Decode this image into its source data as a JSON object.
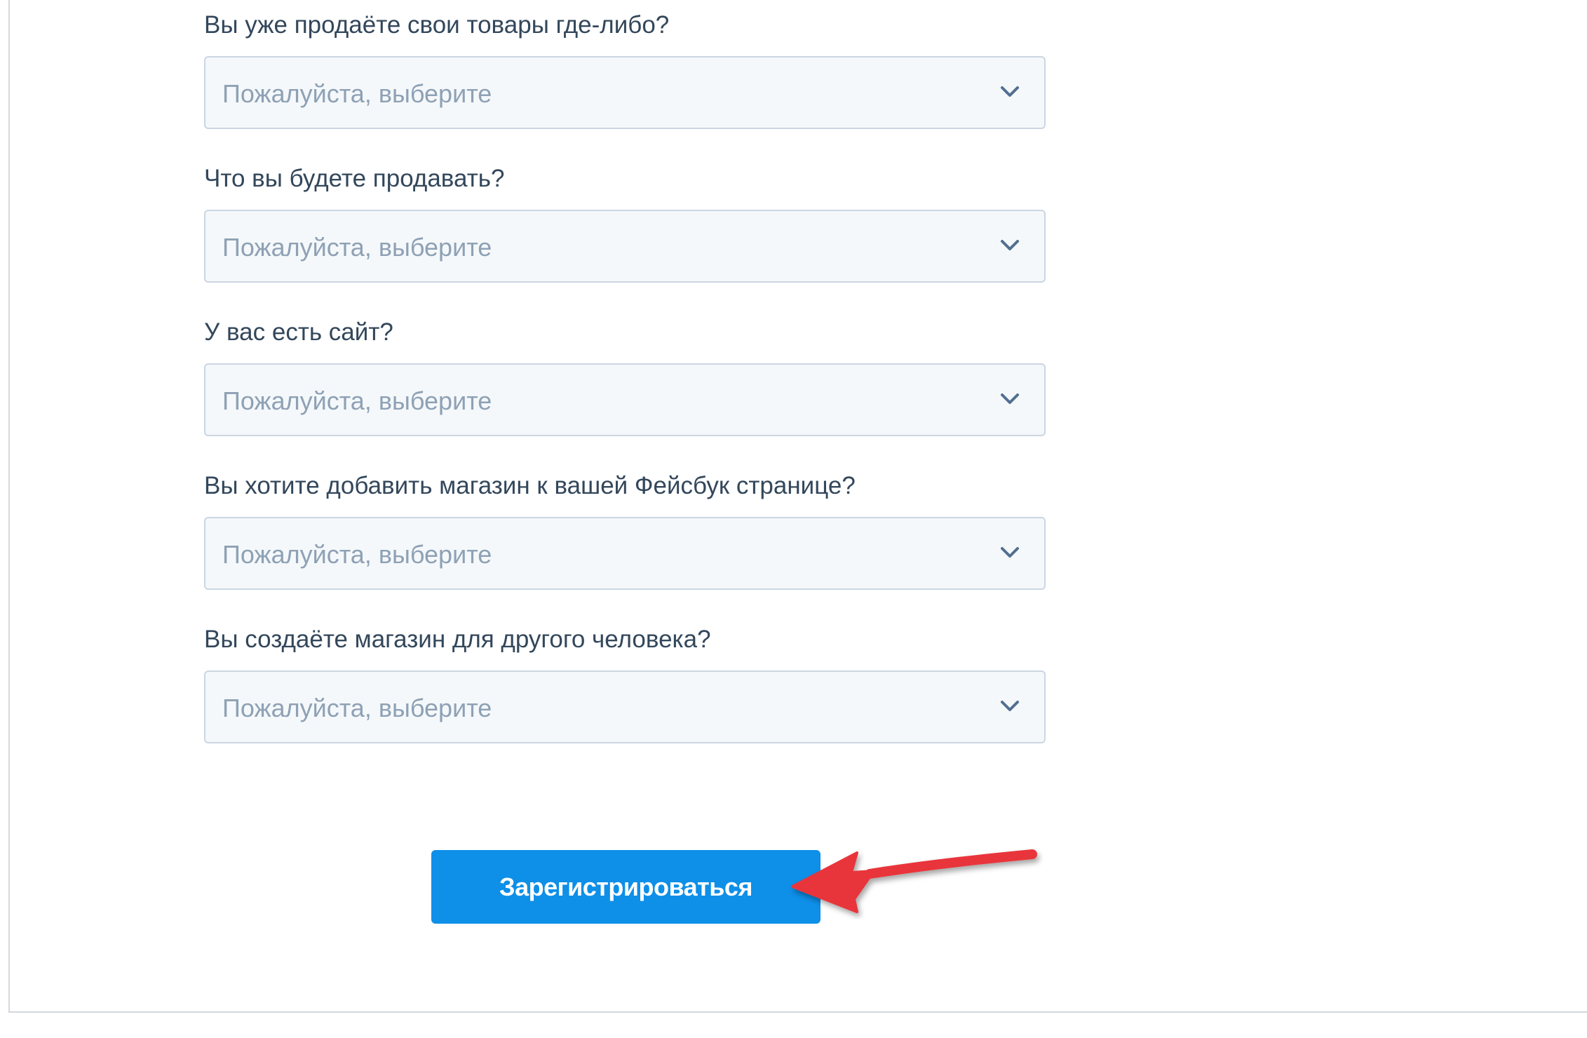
{
  "form": {
    "fields": [
      {
        "label": "Вы уже продаёте свои товары где-либо?",
        "placeholder": "Пожалуйста, выберите"
      },
      {
        "label": "Что вы будете продавать?",
        "placeholder": "Пожалуйста, выберите"
      },
      {
        "label": "У вас есть сайт?",
        "placeholder": "Пожалуйста, выберите"
      },
      {
        "label": "Вы хотите добавить магазин к вашей Фейсбук странице?",
        "placeholder": "Пожалуйста, выберите"
      },
      {
        "label": "Вы создаёте магазин для другого человека?",
        "placeholder": "Пожалуйста, выберите"
      }
    ],
    "submit_label": "Зарегистрироваться"
  },
  "icons": {
    "select_chevron": "chevron-down-icon",
    "annotation": "red-arrow-icon"
  },
  "colors": {
    "button": "#0e8fe8",
    "placeholder": "#8ea1b5",
    "label": "#33475b",
    "select_bg": "#f5f8fa",
    "select_border": "#cbd6e2",
    "arrow": "#e8363b"
  }
}
